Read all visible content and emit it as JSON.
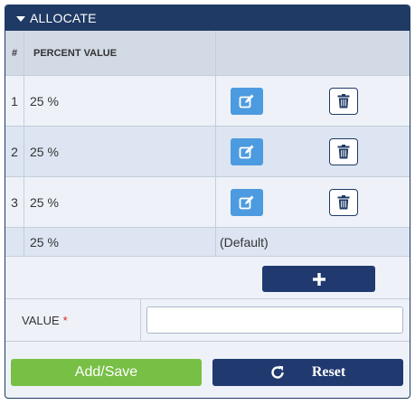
{
  "panel": {
    "title": "ALLOCATE",
    "accent_color": "#1f3a64"
  },
  "table": {
    "headers": {
      "num": "#",
      "percent": "PERCENT VALUE",
      "actions": ""
    },
    "rows": [
      {
        "num": "1",
        "value": "25 %"
      },
      {
        "num": "2",
        "value": "25 %"
      },
      {
        "num": "3",
        "value": "25 %"
      }
    ],
    "default_row": {
      "value": "25 %",
      "label": "(Default)"
    }
  },
  "icons": {
    "edit": "edit-icon",
    "delete": "trash-icon",
    "add": "plus-icon",
    "reset": "refresh-icon",
    "collapse": "caret-down-icon"
  },
  "value_field": {
    "label": "VALUE",
    "required_mark": "*",
    "value": "",
    "placeholder": ""
  },
  "buttons": {
    "save": "Add/Save",
    "reset": "Reset",
    "save_color": "#77bf45",
    "reset_color": "#203a70",
    "edit_color": "#4c9be0"
  }
}
